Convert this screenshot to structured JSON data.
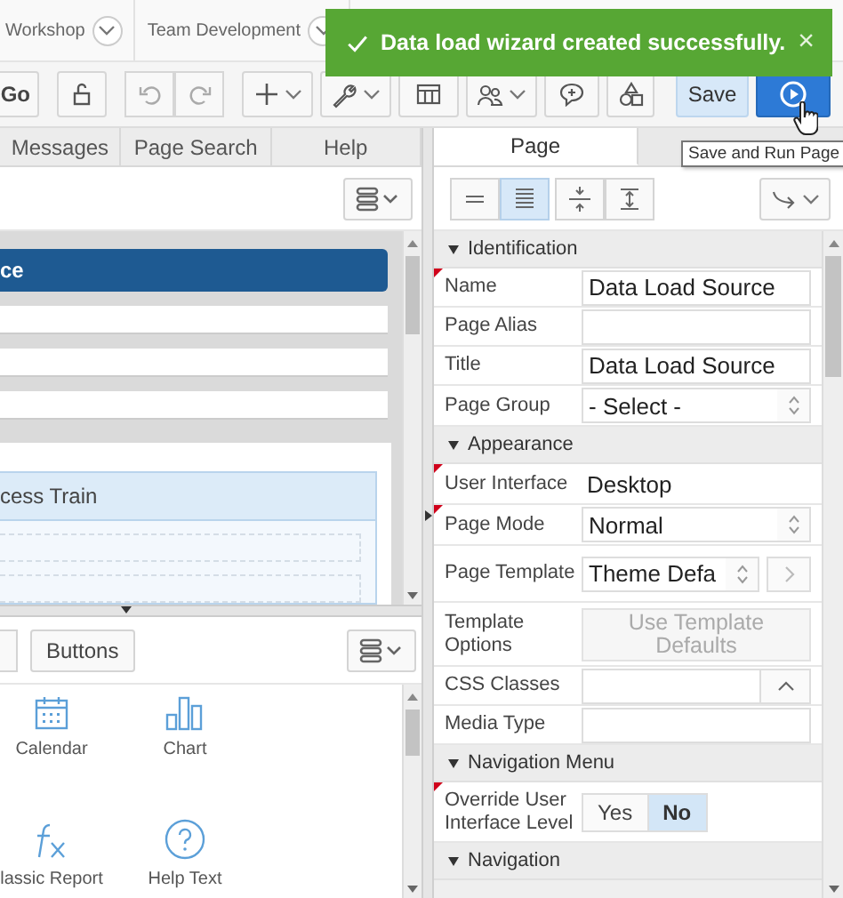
{
  "top_nav": [
    {
      "label": "Workshop"
    },
    {
      "label": "Team Development"
    }
  ],
  "notification": {
    "message": "Data load wizard created successfully.",
    "close": "×"
  },
  "toolbar": {
    "go_button": "Go",
    "save_button": "Save",
    "tooltip": "Save and Run Page"
  },
  "left_panel": {
    "tabs": [
      {
        "label": "Messages",
        "selected": false
      },
      {
        "label": "Page Search",
        "selected": false
      },
      {
        "label": "Help",
        "selected": false
      }
    ],
    "layout": {
      "region_title": "ce",
      "train_region": "cess Train"
    },
    "gallery_tabs": [
      {
        "label": "Buttons",
        "selected": false
      }
    ],
    "gallery": [
      {
        "label": "Calendar",
        "kind": "calendar"
      },
      {
        "label": "Chart",
        "kind": "chart"
      },
      {
        "label": "lassic Report",
        "kind": "function"
      },
      {
        "label": "Help Text",
        "kind": "help"
      }
    ]
  },
  "property_editor": {
    "tabs": [
      {
        "label": "Page",
        "selected": true
      }
    ],
    "view_buttons": [
      {
        "kind": "sparse",
        "selected": false
      },
      {
        "kind": "dense",
        "selected": true
      },
      {
        "kind": "collapse",
        "selected": false
      },
      {
        "kind": "expand",
        "selected": false
      }
    ],
    "groups": [
      {
        "title": "Identification",
        "expanded": true,
        "properties": [
          {
            "label": "Name",
            "kind": "text",
            "value": "Data Load Source",
            "required": true
          },
          {
            "label": "Page Alias",
            "kind": "text"
          },
          {
            "label": "Title",
            "kind": "text",
            "value": "Data Load Source"
          },
          {
            "label": "Page Group",
            "kind": "select",
            "value": "- Select -"
          }
        ]
      },
      {
        "title": "Appearance",
        "expanded": true,
        "properties": [
          {
            "label": "User Interface",
            "kind": "display",
            "value": "Desktop",
            "required": true
          },
          {
            "label": "Page Mode",
            "kind": "select",
            "value": "Normal",
            "required": true
          },
          {
            "label": "Page Template",
            "kind": "select-link",
            "value": "Theme Defa"
          },
          {
            "label": "Template Options",
            "kind": "button",
            "value": "Use Template Defaults"
          },
          {
            "label": "CSS Classes",
            "kind": "popup"
          },
          {
            "label": "Media Type",
            "kind": "text"
          }
        ]
      },
      {
        "title": "Navigation Menu",
        "expanded": true,
        "properties": [
          {
            "label": "Override User Interface Level",
            "kind": "toggle",
            "required": true,
            "options": [
              {
                "label": "Yes",
                "selected": false
              },
              {
                "label": "No",
                "selected": true
              }
            ]
          }
        ]
      },
      {
        "title": "Navigation",
        "expanded": true
      }
    ]
  }
}
